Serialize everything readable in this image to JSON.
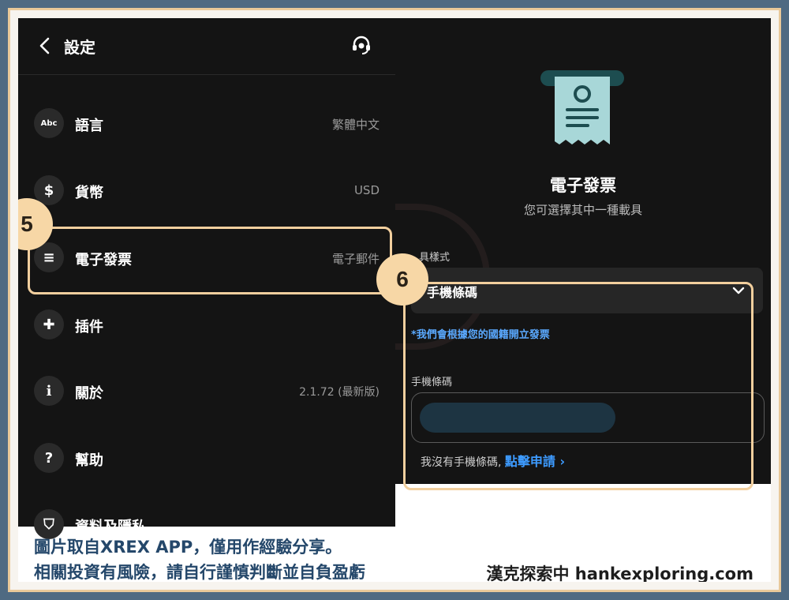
{
  "header": {
    "title": "設定",
    "back_icon": "chevron-left-icon",
    "support_icon": "headset-icon"
  },
  "settings": [
    {
      "icon": "language-icon",
      "icon_text": "Abc",
      "label": "語言",
      "value": "繁體中文"
    },
    {
      "icon": "currency-icon",
      "icon_text": "$",
      "label": "貨幣",
      "value": "USD"
    },
    {
      "icon": "receipt-icon",
      "icon_text": "≡",
      "label": "電子發票",
      "value": "電子郵件"
    },
    {
      "icon": "puzzle-icon",
      "icon_text": "✚",
      "label": "插件",
      "value": ""
    },
    {
      "icon": "info-icon",
      "icon_text": "i",
      "label": "關於",
      "value": "2.1.72 (最新版)"
    },
    {
      "icon": "help-icon",
      "icon_text": "?",
      "label": "幫助",
      "value": ""
    },
    {
      "icon": "shield-icon",
      "icon_text": "⛉",
      "label": "資料及隱私",
      "value": ""
    }
  ],
  "invoice": {
    "title": "電子發票",
    "subtitle": "您可選擇其中一種載具",
    "type_label": "具樣式",
    "selected": "手機條碼",
    "note": "*我們會根據您的國籍開立發票",
    "field_label": "手機條碼",
    "field_value": "",
    "no_barcode_text": "我沒有手機條碼,",
    "apply_link": "點擊申請 ›"
  },
  "annotations": {
    "step5": "5",
    "step6": "6"
  },
  "caption": {
    "line1": "圖片取自XREX APP，僅用作經驗分享。",
    "line2": "相關投資有風險，請自行謹慎判斷並自負盈虧",
    "brand": "漢克探索中 hankexploring.com"
  },
  "colors": {
    "panel_bg": "#141414",
    "highlight": "#f2cf9e",
    "link": "#3d9bff",
    "caption": "#24476a"
  }
}
